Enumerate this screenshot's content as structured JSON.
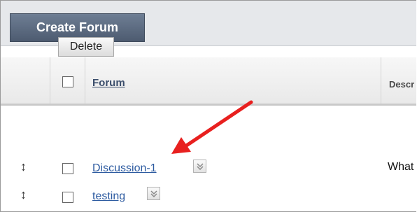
{
  "toolbar": {
    "create_forum_label": "Create Forum",
    "delete_label": "Delete"
  },
  "table": {
    "columns": {
      "forum": "Forum",
      "description": "Descr"
    },
    "rows": [
      {
        "forum": "Discussion-1",
        "description": "What"
      },
      {
        "forum": "testing",
        "description": ""
      }
    ]
  },
  "colors": {
    "accent_button": "#5b6a80",
    "link": "#2c5aa0",
    "annotation_arrow": "#e8201f"
  },
  "icons": {
    "toolbar_arrow": "corner-arrow-icon",
    "row_handle": "drag-handle-icon",
    "row_menu": "double-chevron-down-icon"
  }
}
